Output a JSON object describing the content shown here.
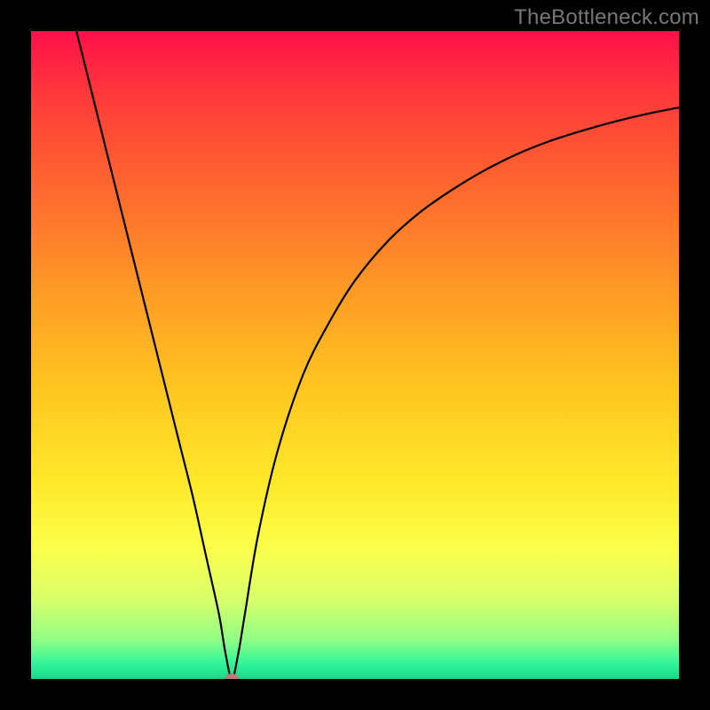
{
  "watermark": "TheBottleneck.com",
  "chart_data": {
    "type": "line",
    "title": "",
    "xlabel": "",
    "ylabel": "",
    "xlim": [
      0,
      100
    ],
    "ylim": [
      0,
      100
    ],
    "grid": false,
    "legend": false,
    "annotations": [],
    "gradient_stops": [
      {
        "offset": 0.0,
        "color": "#ff0f4a"
      },
      {
        "offset": 0.1,
        "color": "#ff3a3a"
      },
      {
        "offset": 0.25,
        "color": "#ff6a2d"
      },
      {
        "offset": 0.4,
        "color": "#ff9a25"
      },
      {
        "offset": 0.55,
        "color": "#ffc61f"
      },
      {
        "offset": 0.7,
        "color": "#ffe92a"
      },
      {
        "offset": 0.8,
        "color": "#fbff4a"
      },
      {
        "offset": 0.88,
        "color": "#d6ff6a"
      },
      {
        "offset": 0.94,
        "color": "#8fff86"
      },
      {
        "offset": 0.975,
        "color": "#34f59a"
      },
      {
        "offset": 1.0,
        "color": "#18da8a"
      }
    ],
    "minimum_marker": {
      "x": 31,
      "y": 0,
      "color": "#c07a7a"
    },
    "series": [
      {
        "name": "curve",
        "type": "line",
        "color": "#000000",
        "points": [
          {
            "x": 7.0,
            "y": 100.0
          },
          {
            "x": 9.0,
            "y": 92.0
          },
          {
            "x": 11.0,
            "y": 84.0
          },
          {
            "x": 13.0,
            "y": 76.0
          },
          {
            "x": 15.0,
            "y": 68.0
          },
          {
            "x": 17.0,
            "y": 60.0
          },
          {
            "x": 19.0,
            "y": 52.0
          },
          {
            "x": 21.0,
            "y": 44.0
          },
          {
            "x": 23.0,
            "y": 36.0
          },
          {
            "x": 25.0,
            "y": 28.0
          },
          {
            "x": 27.0,
            "y": 19.0
          },
          {
            "x": 29.0,
            "y": 10.0
          },
          {
            "x": 30.0,
            "y": 4.0
          },
          {
            "x": 31.0,
            "y": 0.0
          },
          {
            "x": 32.0,
            "y": 4.0
          },
          {
            "x": 33.0,
            "y": 10.0
          },
          {
            "x": 35.0,
            "y": 22.0
          },
          {
            "x": 38.0,
            "y": 35.0
          },
          {
            "x": 42.0,
            "y": 47.0
          },
          {
            "x": 46.0,
            "y": 55.0
          },
          {
            "x": 50.0,
            "y": 61.5
          },
          {
            "x": 55.0,
            "y": 67.5
          },
          {
            "x": 60.0,
            "y": 72.0
          },
          {
            "x": 65.0,
            "y": 75.5
          },
          {
            "x": 70.0,
            "y": 78.5
          },
          {
            "x": 75.0,
            "y": 81.0
          },
          {
            "x": 80.0,
            "y": 83.0
          },
          {
            "x": 85.0,
            "y": 84.6
          },
          {
            "x": 90.0,
            "y": 86.0
          },
          {
            "x": 95.0,
            "y": 87.2
          },
          {
            "x": 100.0,
            "y": 88.2
          }
        ]
      }
    ]
  }
}
